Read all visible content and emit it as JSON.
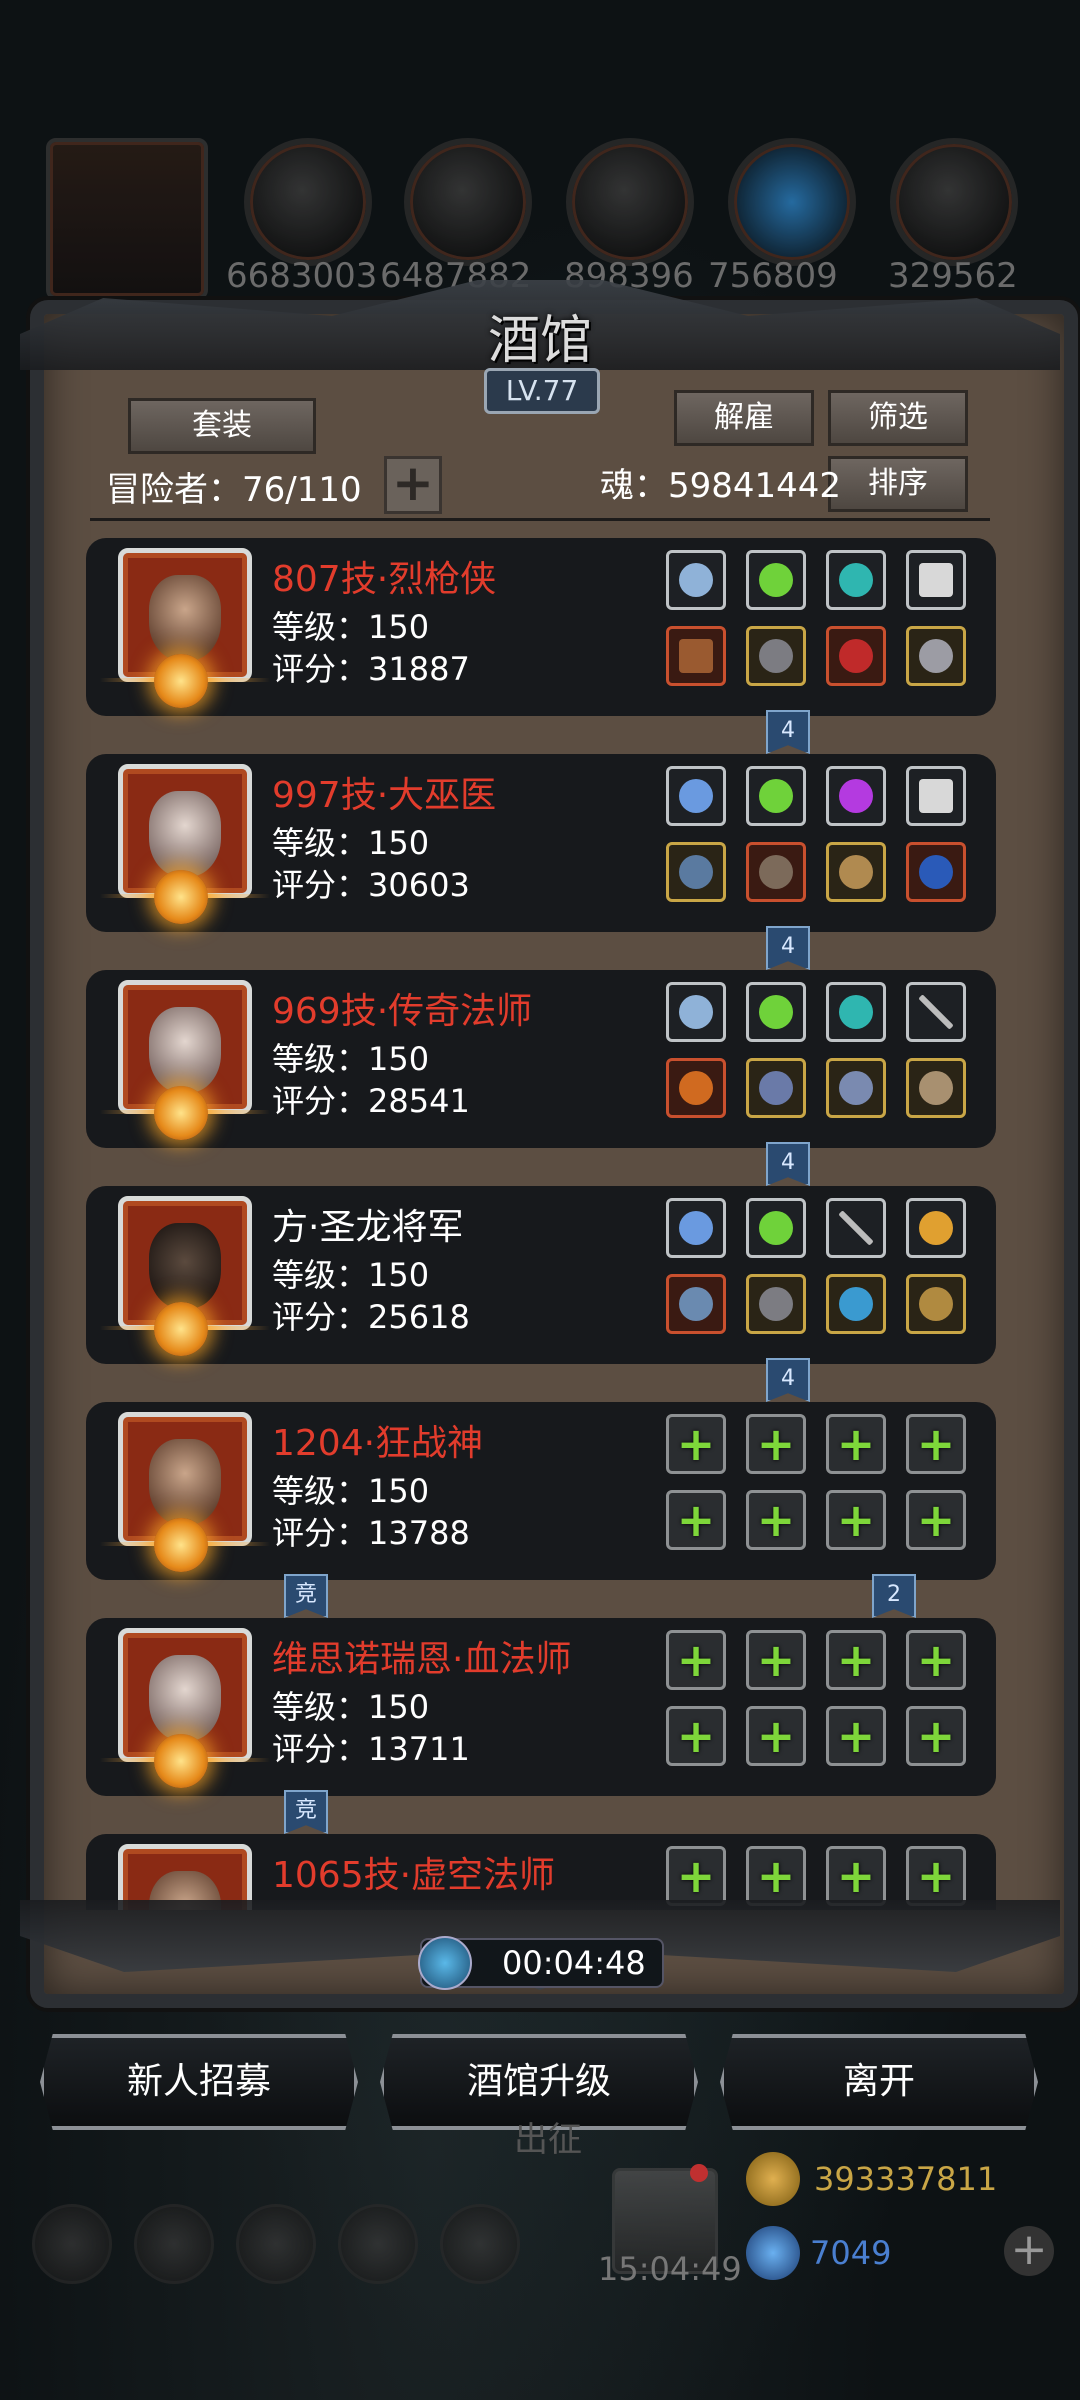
{
  "resources": [
    "6683003",
    "6487882",
    "898396",
    "756809",
    "329562"
  ],
  "tavern": {
    "title": "酒馆",
    "level": "LV.77",
    "set_label": "套装",
    "dismiss_label": "解雇",
    "filter_label": "筛选",
    "sort_label": "排序",
    "adventurers_label": "冒险者：76/110",
    "soul_label": "魂：59841442"
  },
  "heroes": [
    {
      "name": "807技·烈枪侠",
      "level": "等级：150",
      "score": "评分：31887",
      "name_color": "#e23c2c"
    },
    {
      "name": "997技·大巫医",
      "level": "等级：150",
      "score": "评分：30603",
      "name_color": "#e23c2c"
    },
    {
      "name": "969技·传奇法师",
      "level": "等级：150",
      "score": "评分：28541",
      "name_color": "#e23c2c"
    },
    {
      "name": "方·圣龙将军",
      "level": "等级：150",
      "score": "评分：25618",
      "name_color": "#ffffff"
    },
    {
      "name": "1204·狂战神",
      "level": "等级：150",
      "score": "评分：13788",
      "name_color": "#e23c2c"
    },
    {
      "name": "维思诺瑞恩·血法师",
      "level": "等级：150",
      "score": "评分：13711",
      "name_color": "#e23c2c"
    },
    {
      "name": "1065技·虚空法师",
      "level": "",
      "score": "",
      "name_color": "#e23c2c"
    }
  ],
  "row_tags": {
    "four": "4",
    "compete": "竞",
    "two": "2"
  },
  "timer": "00:04:48",
  "buttons": {
    "recruit": "新人招募",
    "upgrade": "酒馆升级",
    "leave": "离开"
  },
  "hud": {
    "clock": "15:04:49",
    "gold": "393337811",
    "gems": "7049",
    "behind_label": "出征"
  },
  "colors": {
    "panel": "#5c4e42",
    "accent_red": "#e23c2c",
    "gold_text": "#c9a646",
    "gem_text": "#4a7fd0"
  }
}
